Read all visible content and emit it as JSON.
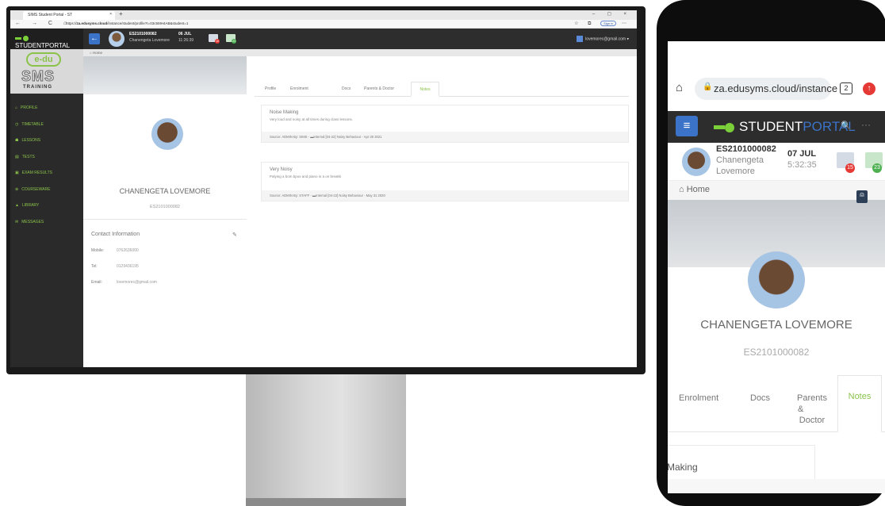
{
  "desktop": {
    "browser": {
      "tab_title": "SIMS Student Portal - ST",
      "tab_close": "×",
      "new_tab": "+",
      "window_controls": "– ◻ ×",
      "nav": "← → C ⌂",
      "url_prefix": "https://",
      "url_host": "za.edusyms.cloud",
      "url_path": "/instance/student/profile?t=03c5MH4AB&student=1",
      "sign_in": "Sign in"
    },
    "app": {
      "brand": "STUDENTPORTAL",
      "student_id": "ES2101000082",
      "student_name": "Chanengeta Lovemore",
      "date": "06 JUL",
      "time": "11:26:39",
      "news_badge": "15",
      "msg_badge": "23",
      "user_email": "lovemorec@gmail.com ▾",
      "breadcrumb": "⌂ Home",
      "logo_edu": "e-du",
      "logo_sms": "SMS",
      "logo_training": "TRAINING",
      "menu": [
        {
          "icon": "⌂",
          "label": "PROFILE"
        },
        {
          "icon": "◷",
          "label": "TIMETABLE"
        },
        {
          "icon": "☗",
          "label": "LESSONS"
        },
        {
          "icon": "▤",
          "label": "TESTS"
        },
        {
          "icon": "▣",
          "label": "EXAM RESULTS"
        },
        {
          "icon": "⊕",
          "label": "COURSEWARE"
        },
        {
          "icon": "▲",
          "label": "LIBRARY"
        },
        {
          "icon": "✉",
          "label": "MESSAGES"
        }
      ],
      "profile": {
        "name": "CHANENGETA LOVEMORE",
        "id": "ES2101000082",
        "contact_title": "Contact Information",
        "edit": "✎",
        "mobile_label": "Mobile:",
        "mobile": "0762636000",
        "tel_label": "Tel:",
        "tel": "0129436195",
        "email_label": "Email:",
        "email": "lovemorec@gmail.com"
      },
      "tabs": [
        "Profile",
        "Enrolment",
        "Docs",
        "Parents & Doctor",
        "Notes"
      ],
      "notes": [
        {
          "title": "Noise Making",
          "desc": "Very loud and noisy at all times during class lessons.",
          "source": "Source: ADMIN By: SIMS - ▬Internal [04-22] Noisy Behaviour - Apr 30 2021"
        },
        {
          "title": "Very Noisy",
          "desc": "Palying a bom bpox and piano in a on breakk",
          "source": "Source: ADMIN By: STAFF - ▬Internal [04-22] Noisy Behaviour - May 31 2020"
        }
      ]
    }
  },
  "phone": {
    "url": "za.edusyms.cloud/instance",
    "tab_count": "2",
    "brand_student": "STUDENT",
    "brand_portal": "PORTAL",
    "student_id": "ES2101000082",
    "name_line1": "Chanengeta",
    "name_line2": "Lovemore",
    "date": "07 JUL",
    "time": "5:32:35",
    "news_badge": "15",
    "msg_badge": "23",
    "breadcrumb": "⌂ Home",
    "profile_name": "CHANENGETA LOVEMORE",
    "profile_id": "ES2101000082",
    "tab_enrolment": "Enrolment",
    "tab_docs": "Docs",
    "tab_parents_1": "Parents",
    "tab_parents_2": "&",
    "tab_parents_3": "Doctor",
    "tab_notes": "Notes",
    "note_partial": "Making"
  },
  "colors": {
    "accent_green": "#8bc34a",
    "accent_blue": "#3a73c8",
    "badge_red": "#e53935",
    "badge_green": "#4caf50"
  }
}
